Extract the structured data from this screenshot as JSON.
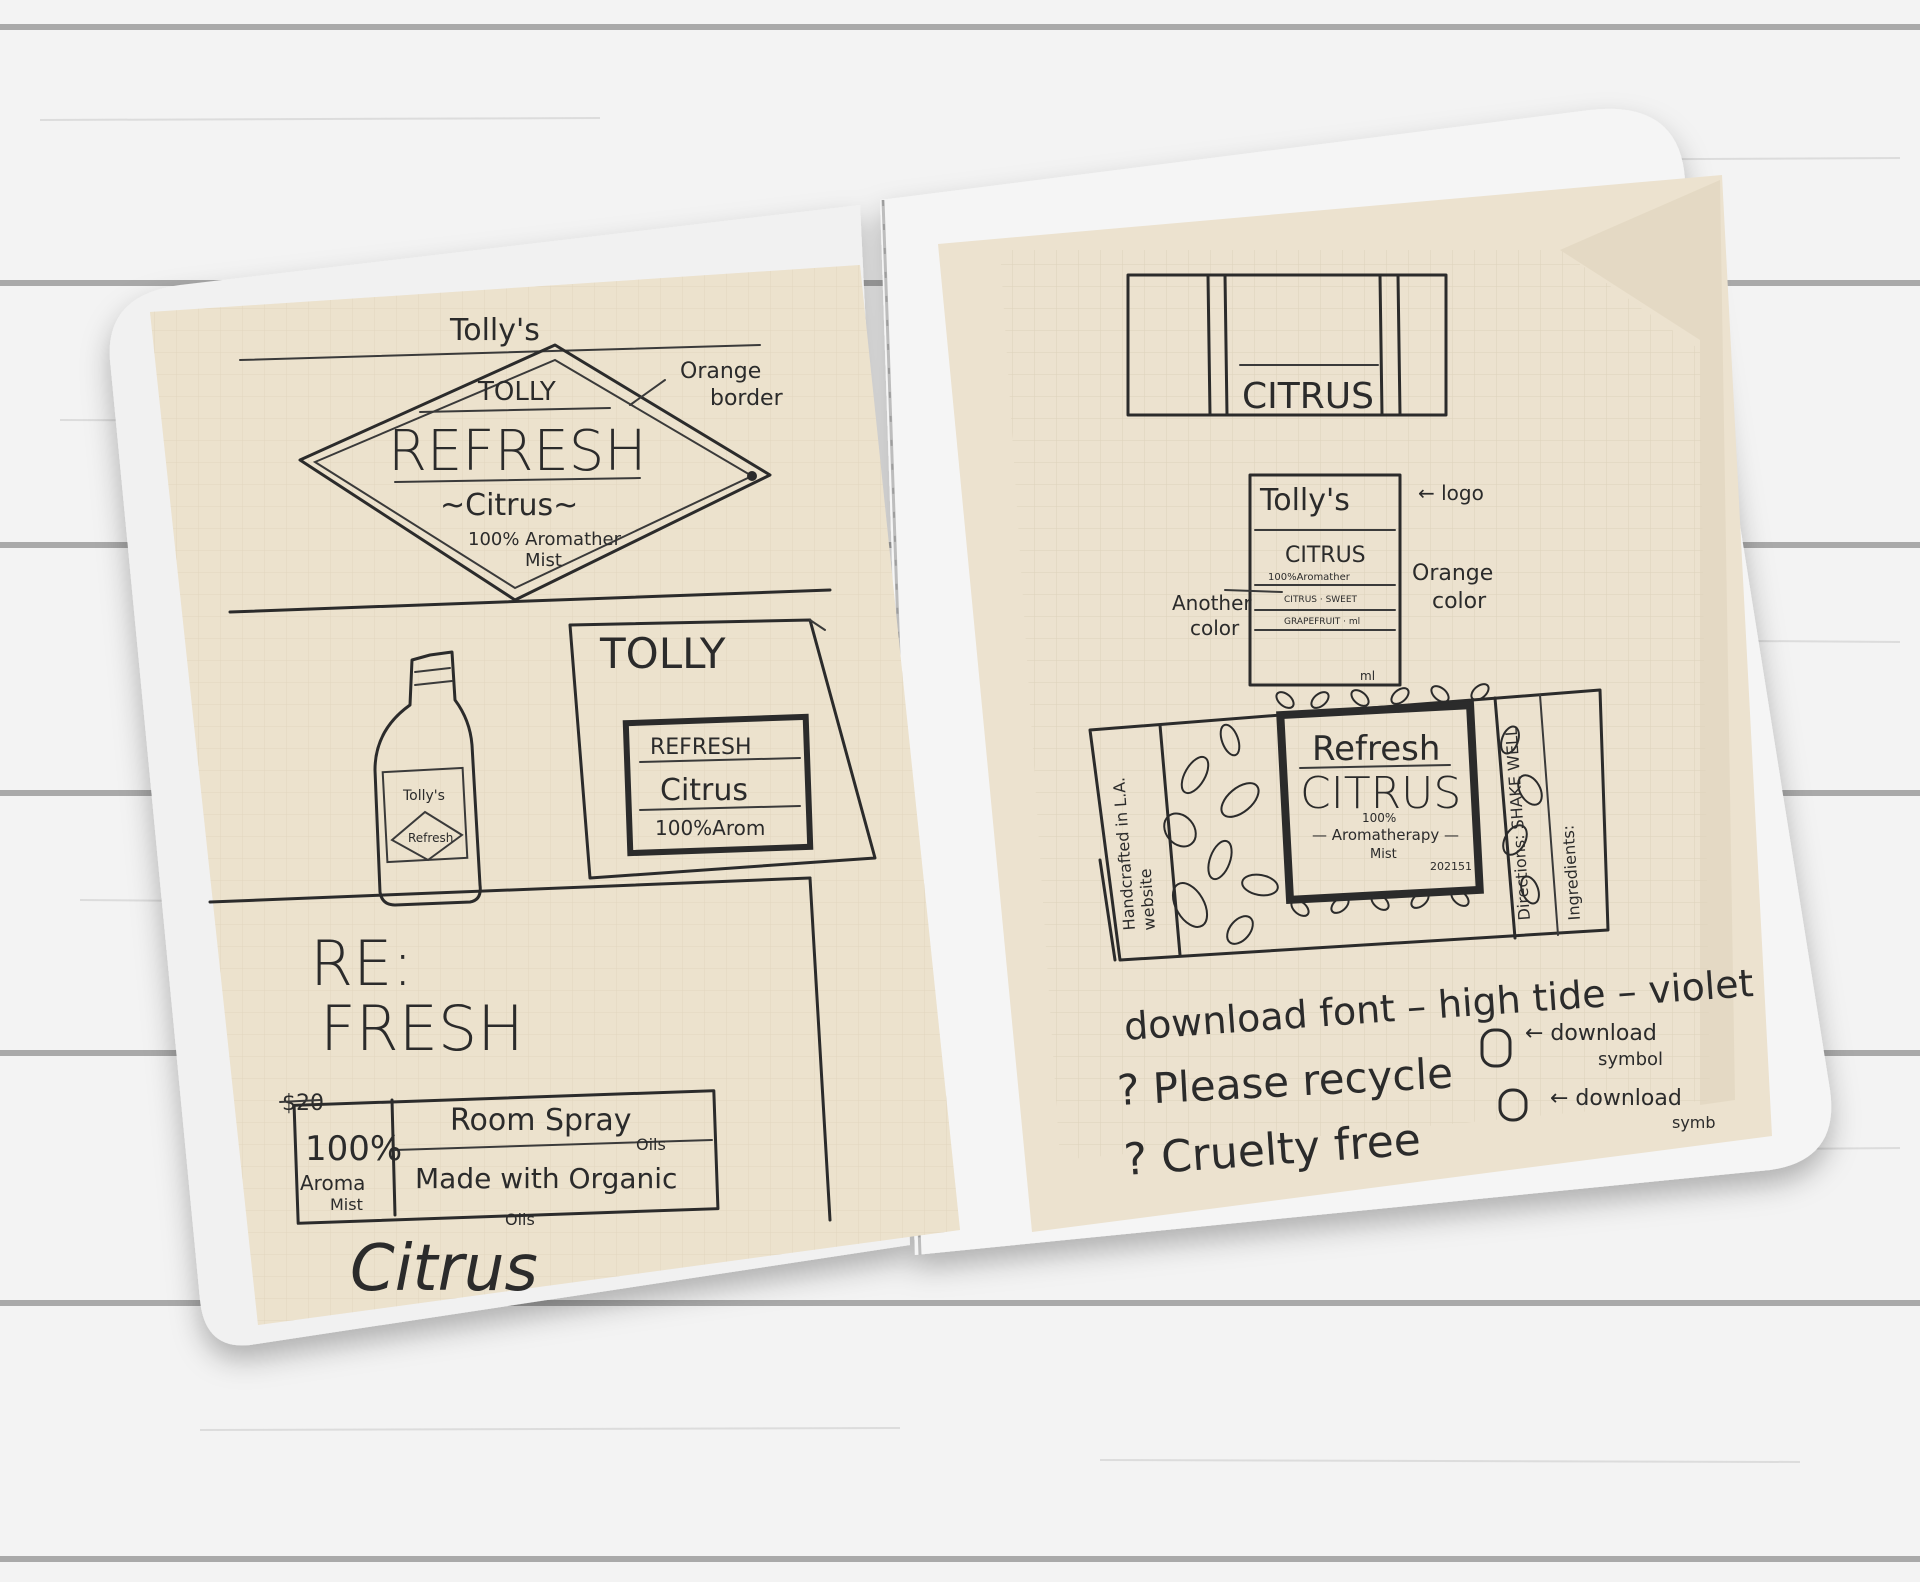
{
  "left_page": {
    "top_sketch": {
      "header": "Tolly's",
      "brand": "TOLLY",
      "title": "REFRESH",
      "subtitle": "~Citrus~",
      "tagline_1": "100% Aromather",
      "tagline_2": "Mist",
      "note_1": "Orange",
      "note_2": "border"
    },
    "bottle_label": {
      "line_1": "Tolly's",
      "line_2": "Refresh"
    },
    "box_sketch": {
      "brand": "TOLLY",
      "title": "REFRESH",
      "subtitle": "Citrus",
      "tagline": "100%Arom"
    },
    "bottom_sketch": {
      "line_1": "RE:",
      "line_2": "FRESH",
      "price": "$20",
      "percent": "100%",
      "aroma": "Aroma",
      "mist": "Mist",
      "room_spray": "Room Spray",
      "made_with": "Made with Organic",
      "oils_above": "Oils",
      "oils_below": "Oils",
      "scent": "Citrus"
    }
  },
  "right_page": {
    "top_box": {
      "label": "CITRUS"
    },
    "small_box": {
      "logo": "Tolly's",
      "logo_note": "← logo",
      "title": "CITRUS",
      "small_1": "100%Aromather",
      "small_2": "CITRUS · SWEET",
      "small_3": "GRAPEFRUIT · ml",
      "unit": "ml",
      "note_left_1": "Another",
      "note_left_2": "color",
      "note_right_1": "Orange",
      "note_right_2": "color"
    },
    "flat_box": {
      "title": "Refresh",
      "name": "CITRUS",
      "percent": "100%",
      "line_1": "— Aromatherapy —",
      "line_2": "Mist",
      "code": "202151",
      "side_left_1": "Handcrafted in L.A.",
      "side_left_2": "website",
      "side_right_1": "Directions: SHAKE WELL",
      "side_right_2": "Ingredients:"
    },
    "notes": {
      "line_1": "download font – high tide – violet",
      "line_2": "? Please recycle",
      "line_2_note_1": "← download",
      "line_2_note_2": "symbol",
      "line_3": "? Cruelty free",
      "line_3_note_1": "← download",
      "line_3_note_2": "symb"
    }
  }
}
